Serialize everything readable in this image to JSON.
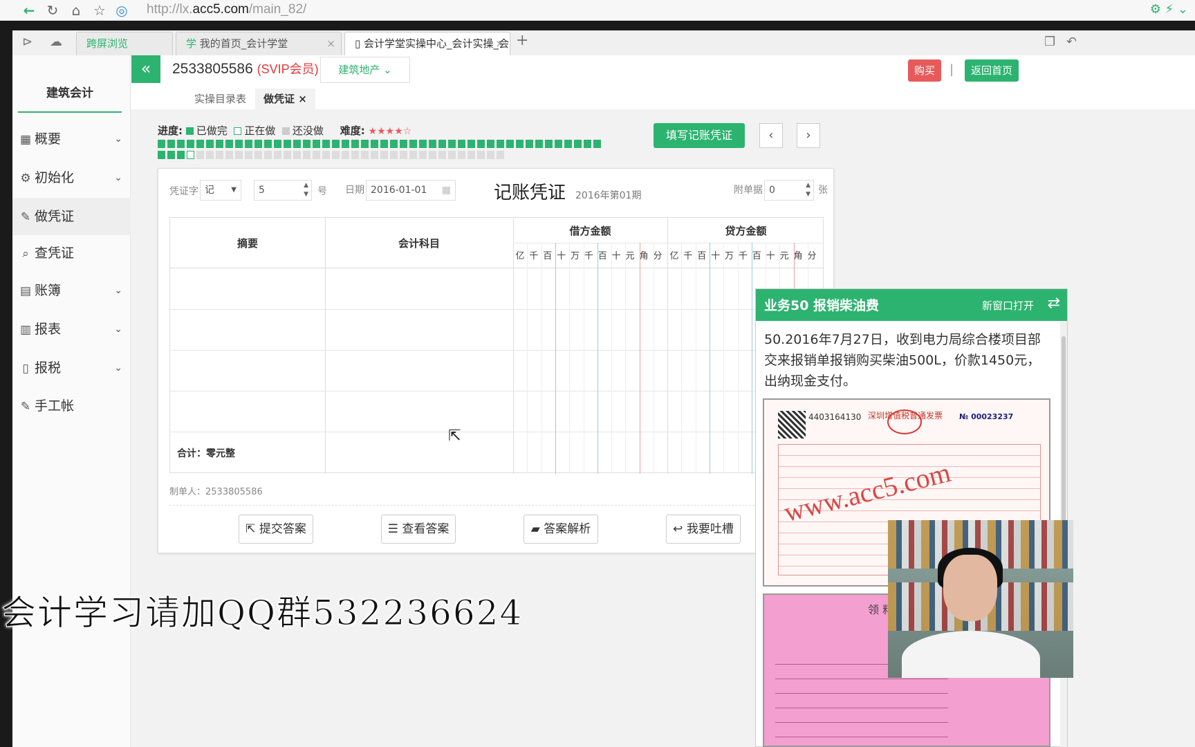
{
  "browser": {
    "url_prefix": "http://lx.",
    "url_domain": "acc5.com",
    "url_path": "/main_82/",
    "tabs": [
      {
        "label": "跨屏浏览"
      },
      {
        "label": "我的首页_会计学堂"
      },
      {
        "label": "会计学堂实操中心_会计实操_会"
      }
    ],
    "new_tab": "+"
  },
  "sidebar": {
    "title": "建筑会计",
    "items": [
      {
        "label": "概要",
        "icon": "dashboard-icon"
      },
      {
        "label": "初始化",
        "icon": "gear-icon"
      },
      {
        "label": "做凭证",
        "icon": "pen-icon"
      },
      {
        "label": "查凭证",
        "icon": "search-icon"
      },
      {
        "label": "账簿",
        "icon": "ledger-icon"
      },
      {
        "label": "报表",
        "icon": "report-icon"
      },
      {
        "label": "报税",
        "icon": "file-icon"
      },
      {
        "label": "手工帐",
        "icon": "pen-icon"
      }
    ]
  },
  "topbar": {
    "user_id": "2533805586",
    "member": "(SVIP会员)",
    "industry": "建筑地产",
    "buy": "购买",
    "separator": "|",
    "home": "返回首页"
  },
  "subtabs": {
    "list": "实操目录表",
    "current": "做凭证",
    "close": "×"
  },
  "progress": {
    "label": "进度:",
    "done": "已做完",
    "doing": "正在做",
    "todo": "还没做",
    "difficulty_label": "难度:",
    "difficulty_stars": "★★★★☆",
    "total_tasks": 82,
    "current_task": 50
  },
  "toolbar": {
    "fill_voucher": "填写记账凭证",
    "prev": "‹",
    "next": "›"
  },
  "voucher": {
    "word_label": "凭证字",
    "word_value": "记",
    "number_value": "5",
    "number_suffix": "号",
    "date_label": "日期",
    "date_value": "2016-01-01",
    "title": "记账凭证",
    "period": "2016年第01期",
    "attach_label": "附单据",
    "attach_value": "0",
    "attach_suffix": "张",
    "col_summary": "摘要",
    "col_account": "会计科目",
    "col_debit": "借方金额",
    "col_credit": "贷方金额",
    "digit_units": [
      "亿",
      "千",
      "百",
      "十",
      "万",
      "千",
      "百",
      "十",
      "元",
      "角",
      "分"
    ],
    "total": "合计：零元整",
    "maker": "制单人：2533805586"
  },
  "actions": {
    "submit": "提交答案",
    "view": "查看答案",
    "analysis": "答案解析",
    "feedback": "我要吐槽"
  },
  "task": {
    "title": "业务50 报销柴油费",
    "open_new": "新窗口打开",
    "description": "50.2016年7月27日，收到电力局综合楼项目部交来报销单报销购买柴油500L，价款1450元，出纳现金支付。",
    "invoice_no": "4403164130",
    "invoice_title": "深圳增值税普通发票",
    "invoice_no2": "№ 00023237",
    "watermark": "www.acc5.com",
    "receipt_title": "领 料"
  },
  "overlay_text": "会计学习请加QQ群532236624"
}
